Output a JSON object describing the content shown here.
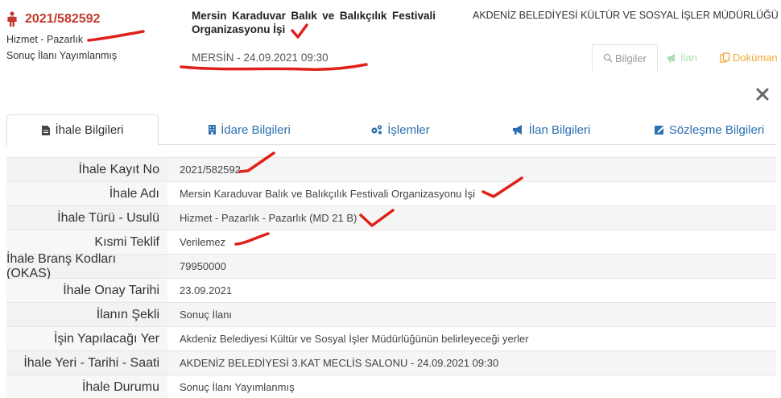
{
  "header": {
    "registration_no": "2021/582592",
    "procurement_type": "Hizmet - Pazarlık",
    "status": "Sonuç İlanı Yayımlanmış",
    "title": "Mersin Karaduvar Balık ve Balıkçılık Festivali Organizasyonu İşi",
    "place_date": "MERSİN - 24.09.2021 09:30",
    "authority": "AKDENİZ BELEDİYESİ KÜLTÜR VE SOSYAL İŞLER MÜDÜRLÜĞÜ"
  },
  "actions": {
    "bilgiler": "Bilgiler",
    "ilan": "İlan",
    "dokuman": "Doküman"
  },
  "tabs": [
    {
      "label": "İhale Bilgileri",
      "icon": "document-icon"
    },
    {
      "label": "İdare Bilgileri",
      "icon": "building-icon"
    },
    {
      "label": "İşlemler",
      "icon": "gears-icon"
    },
    {
      "label": "İlan Bilgileri",
      "icon": "megaphone-icon"
    },
    {
      "label": "Sözleşme Bilgileri",
      "icon": "contract-edit-icon"
    }
  ],
  "details": [
    {
      "label": "İhale Kayıt No",
      "value": "2021/582592"
    },
    {
      "label": "İhale Adı",
      "value": "Mersin Karaduvar Balık ve Balıkçılık Festivali Organizasyonu İşi"
    },
    {
      "label": "İhale Türü - Usulü",
      "value": "Hizmet - Pazarlık - Pazarlık (MD 21 B)"
    },
    {
      "label": "Kısmi Teklif",
      "value": "Verilemez"
    },
    {
      "label": "İhale Branş Kodları (OKAS)",
      "value": "79950000"
    },
    {
      "label": "İhale Onay Tarihi",
      "value": "23.09.2021"
    },
    {
      "label": "İlanın Şekli",
      "value": "Sonuç İlanı"
    },
    {
      "label": "İşin Yapılacağı Yer",
      "value": "Akdeniz Belediyesi Kültür ve Sosyal İşler Müdürlüğünün belirleyeceği yerler"
    },
    {
      "label": "İhale Yeri - Tarihi - Saati",
      "value": "AKDENİZ BELEDİYESİ 3.KAT MECLİS SALONU - 24.09.2021 09:30"
    },
    {
      "label": "İhale Durumu",
      "value": "Sonuç İlanı Yayımlanmış"
    }
  ],
  "colors": {
    "accent_red": "#c0392b",
    "link_blue": "#2a6fb0",
    "ilan_green": "#a9dfb2",
    "dokuman_orange": "#f0a83a",
    "annotation_red": "#e0201a"
  }
}
